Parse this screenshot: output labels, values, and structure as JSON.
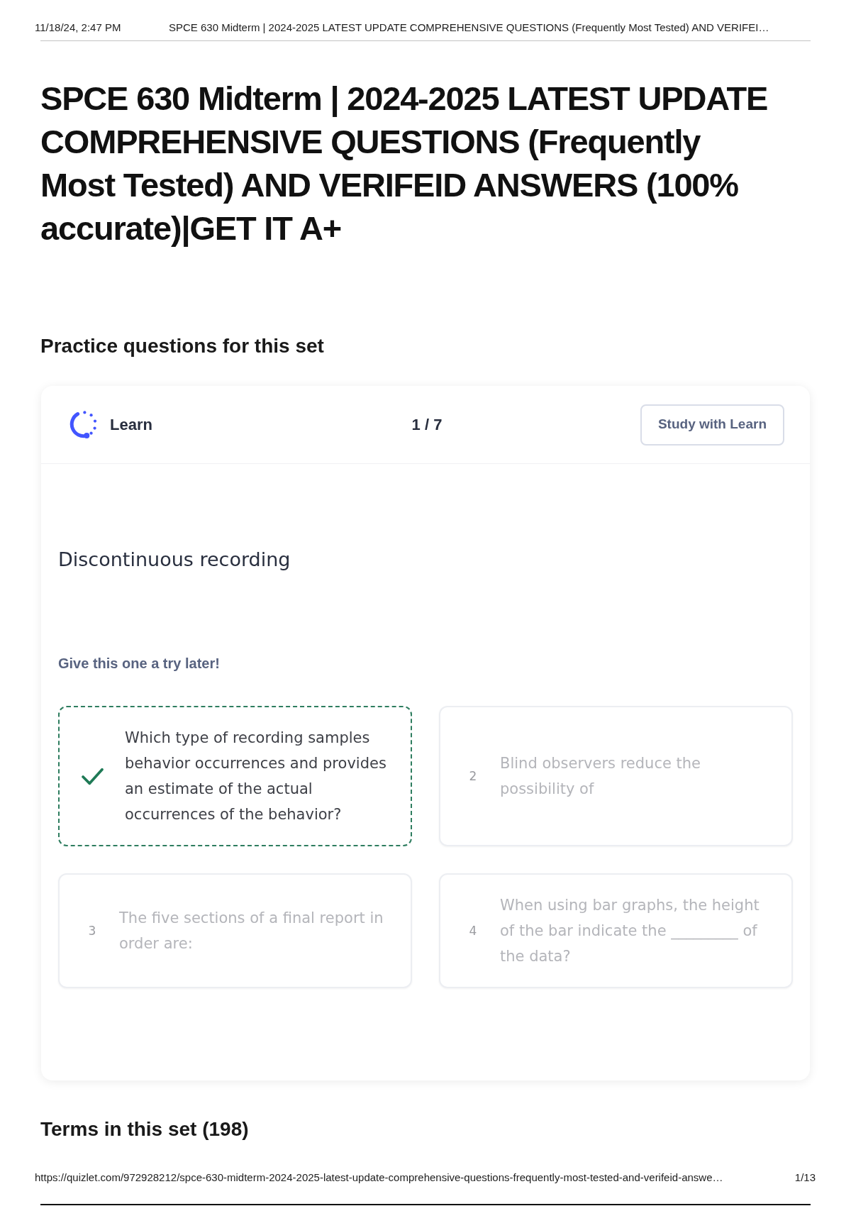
{
  "print_header": {
    "date": "11/18/24, 2:47 PM",
    "title": "SPCE 630 Midterm | 2024-2025 LATEST UPDATE COMPREHENSIVE QUESTIONS (Frequently Most Tested) AND VERIFEI…"
  },
  "title": "SPCE 630 Midterm | 2024-2025 LATEST UPDATE COMPREHENSIVE QUESTIONS (Frequently Most Tested) AND VERIFEID ANSWERS (100% accurate)|GET IT A+",
  "practice": {
    "heading": "Practice questions for this set",
    "learn": {
      "label": "Learn",
      "progress": "1 / 7",
      "button": "Study with Learn",
      "term": "Discontinuous recording",
      "hint": "Give this one a try later!",
      "options": [
        {
          "text": "Which type of recording samples behavior occurrences and provides an estimate of the actual occurrences of the behavior?",
          "correct": true
        },
        {
          "number": "2",
          "text": "Blind observers reduce the possibility of",
          "correct": false
        },
        {
          "number": "3",
          "text": "The five sections of a final report in order are:",
          "correct": false
        },
        {
          "number": "4",
          "text": "When using bar graphs, the height of the bar indicate the _________ of the data?",
          "correct": false
        }
      ]
    }
  },
  "terms_heading": "Terms in this set (198)",
  "print_footer": {
    "url": "https://quizlet.com/972928212/spce-630-midterm-2024-2025-latest-update-comprehensive-questions-frequently-most-tested-and-verifeid-answe…",
    "page": "1/13"
  }
}
